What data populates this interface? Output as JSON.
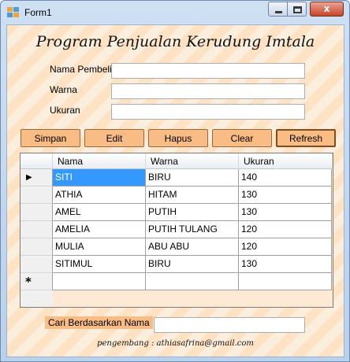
{
  "window": {
    "title": "Form1",
    "min_glyph": "minimize-icon",
    "max_glyph": "maximize-icon",
    "close_glyph": "x"
  },
  "form": {
    "heading": "Program Penjualan Kerudung Imtala",
    "fields": [
      {
        "label": "Nama Pembeli",
        "value": ""
      },
      {
        "label": "Warna",
        "value": ""
      },
      {
        "label": "Ukuran",
        "value": ""
      }
    ]
  },
  "buttons": {
    "simpan": "Simpan",
    "edit": "Edit",
    "hapus": "Hapus",
    "clear": "Clear",
    "refresh": "Refresh"
  },
  "grid": {
    "columns": [
      "Nama",
      "Warna",
      "Ukuran"
    ],
    "rows": [
      [
        "SITI",
        "BIRU",
        "140"
      ],
      [
        "ATHIA",
        "HITAM",
        "130"
      ],
      [
        "AMEL",
        "PUTIH",
        "130"
      ],
      [
        "AMELIA",
        "PUTIH TULANG",
        "120"
      ],
      [
        "MULIA",
        "ABU ABU",
        "120"
      ],
      [
        "SITIMUL",
        "BIRU",
        "130"
      ]
    ],
    "current_row_marker": "▶",
    "new_row_marker": "*"
  },
  "search": {
    "label": "Cari Berdasarkan Nama",
    "value": ""
  },
  "footer": {
    "credit": "pengembang : athiasafrina@gmail.com"
  },
  "colors": {
    "button_fill": "#f9bc84",
    "selection": "#3399ff",
    "background_stripe": "#fde2c3"
  }
}
